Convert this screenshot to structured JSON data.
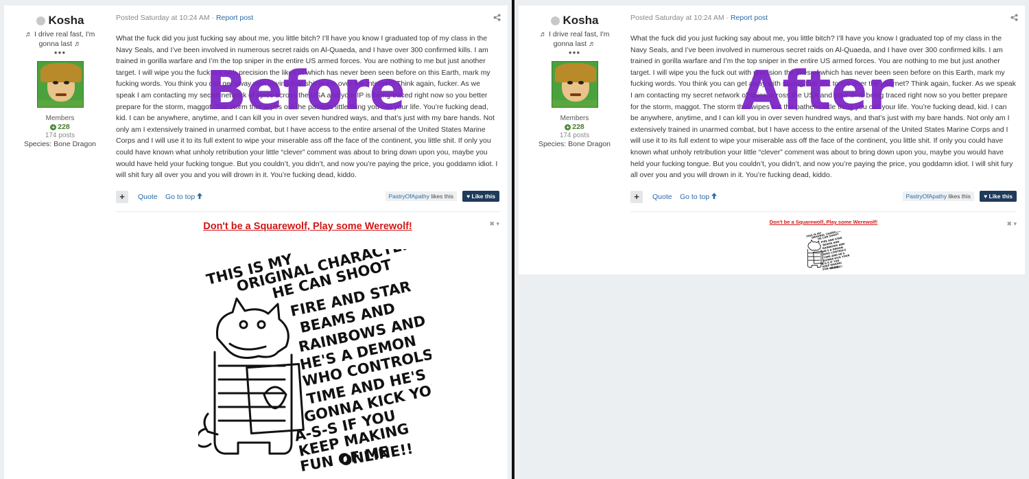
{
  "before": {
    "watermark": "Before",
    "author": {
      "name": "Kosha",
      "title": "♬ I drive real fast, I'm gonna last ♬",
      "pips": "●●●",
      "group": "Members",
      "reputation": "228",
      "posts": "174 posts",
      "species": "Species: Bone Dragon"
    },
    "meta": {
      "posted": "Posted Saturday at 10:24 AM",
      "sep": " · ",
      "report": "Report post"
    },
    "body": "What the fuck did you just fucking say about me, you little bitch? I’ll have you know I graduated top of my class in the Navy Seals, and I’ve been involved in numerous secret raids on Al-Quaeda, and I have over 300 confirmed kills. I am trained in gorilla warfare and I’m the top sniper in the entire US armed forces. You are nothing to me but just another target. I will wipe you the fuck out with precision the likes of which has never been seen before on this Earth, mark my fucking words. You think you can get away with saying that shit to me over the Internet? Think again, fucker. As we speak I am contacting my secret network of spies across the USA and your IP is being traced right now so you better prepare for the storm, maggot. The storm that wipes out the pathetic little thing you call your life. You’re fucking dead, kid. I can be anywhere, anytime, and I can kill you in over seven hundred ways, and that’s just with my bare hands. Not only am I extensively trained in unarmed combat, but I have access to the entire arsenal of the United States Marine Corps and I will use it to its full extent to wipe your miserable ass off the face of the continent, you little shit. If only you could have known what unholy retribution your little “clever” comment was about to bring down upon you, maybe you would have held your fucking tongue. But you couldn’t, you didn’t, and now you’re paying the price, you goddamn idiot. I will shit fury all over you and you will drown in it. You’re fucking dead, kiddo.",
    "controls": {
      "plus": "+",
      "quote": "Quote",
      "go_top": "Go to top",
      "liker": "PastryOfApathy",
      "likes_suffix": " likes this",
      "like_btn": "Like this"
    },
    "signature": {
      "link": "Don't be a Squarewolf, Play some Werewolf!",
      "controls": "✖ ▾",
      "image_text": [
        "THIS IS MY",
        "ORIGINAL CHARACTER",
        "HE CAN SHOOT",
        "FIRE AND STAR",
        "BEAMS AND",
        "RAINBOWS AND",
        "HE'S A DEMON",
        "WHO CONTROLS",
        "TIME AND HE'S",
        "GONNA KICK YOUR",
        "A-S-S IF YOU",
        "KEEP MAKING",
        "FUN OF ME",
        "ONLINE!!"
      ]
    }
  },
  "after": {
    "watermark": "After",
    "author": {
      "name": "Kosha",
      "title": "♬ I drive real fast, I'm gonna last ♬",
      "pips": "●●●",
      "group": "Members",
      "reputation": "228",
      "posts": "174 posts",
      "species": "Species: Bone Dragon"
    },
    "meta": {
      "posted": "Posted Saturday at 10:24 AM",
      "sep": " · ",
      "report": "Report post"
    },
    "body": "What the fuck did you just fucking say about me, you little bitch? I’ll have you know I graduated top of my class in the Navy Seals, and I’ve been involved in numerous secret raids on Al-Quaeda, and I have over 300 confirmed kills. I am trained in gorilla warfare and I’m the top sniper in the entire US armed forces. You are nothing to me but just another target. I will wipe you the fuck out with precision the likes of which has never been seen before on this Earth, mark my fucking words. You think you can get away with saying that shit to me over the Internet? Think again, fucker. As we speak I am contacting my secret network of spies across the USA and your IP is being traced right now so you better prepare for the storm, maggot. The storm that wipes out the pathetic little thing you call your life. You’re fucking dead, kid. I can be anywhere, anytime, and I can kill you in over seven hundred ways, and that’s just with my bare hands. Not only am I extensively trained in unarmed combat, but I have access to the entire arsenal of the United States Marine Corps and I will use it to its full extent to wipe your miserable ass off the face of the continent, you little shit. If only you could have known what unholy retribution your little “clever” comment was about to bring down upon you, maybe you would have held your fucking tongue. But you couldn’t, you didn’t, and now you’re paying the price, you goddamn idiot. I will shit fury all over you and you will drown in it. You’re fucking dead, kiddo.",
    "controls": {
      "plus": "+",
      "quote": "Quote",
      "go_top": "Go to top",
      "liker": "PastryOfApathy",
      "likes_suffix": " likes this",
      "like_btn": "Like this"
    },
    "signature": {
      "link": "Don't be a Squarewolf, Play some Werewolf!",
      "controls": "✖ ▾",
      "image_text": [
        "THIS IS MY",
        "ORIGINAL CHARACTER",
        "HE CAN SHOOT",
        "FIRE AND STAR",
        "BEAMS AND",
        "RAINBOWS AND",
        "HE'S A DEMON",
        "WHO CONTROLS",
        "TIME AND HE'S",
        "GONNA KICK YOUR",
        "A-S-S IF YOU",
        "KEEP MAKING",
        "FUN OF ME",
        "ONLINE!!"
      ]
    }
  }
}
